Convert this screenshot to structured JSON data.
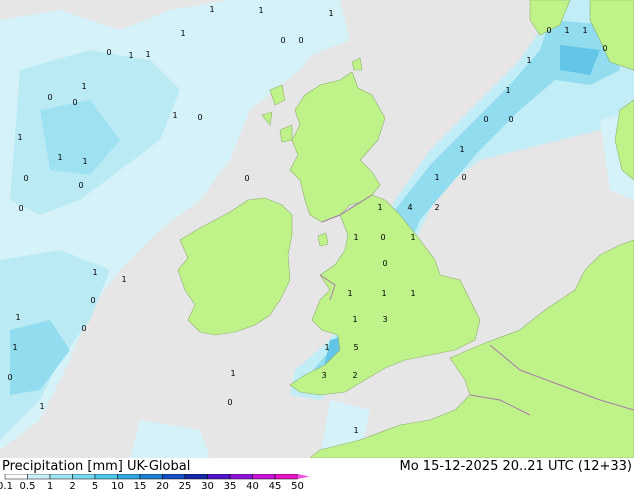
{
  "footer": {
    "title_left": "Precipitation [mm]  UK-Global",
    "title_right": "Mo 15-12-2025 20..21 UTC (12+33)"
  },
  "legend": {
    "labels": [
      "0.1",
      "0.5",
      "1",
      "2",
      "5",
      "10",
      "15",
      "20",
      "25",
      "30",
      "35",
      "40",
      "45",
      "50"
    ],
    "colors": [
      "#ffffff",
      "#c8f0f8",
      "#a0e4f4",
      "#78d8f0",
      "#50c8ec",
      "#30a8e0",
      "#1e7fd0",
      "#1450c0",
      "#1428a8",
      "#5014c8",
      "#8c14d8",
      "#c814d8",
      "#e614c8",
      "#f050e0"
    ]
  },
  "colors": {
    "sea": "#e6e6e6",
    "land": "#bff38a",
    "border": "#aa7aaa",
    "precip_light": "#c8f0f8",
    "precip_mid": "#8edcf0",
    "precip_heavy": "#5cc4e8"
  },
  "map_values": [
    "1",
    "1",
    "0",
    "1",
    "1",
    "1",
    "0",
    "1",
    "1",
    "1",
    "0",
    "0",
    "1",
    "0",
    "0",
    "1",
    "1",
    "4",
    "2",
    "1",
    "1",
    "0",
    "1",
    "0",
    "0",
    "1",
    "1",
    "1",
    "3",
    "1",
    "5",
    "3",
    "2",
    "1",
    "1",
    "1",
    "0",
    "1",
    "1",
    "0",
    "0",
    "1",
    "1",
    "0",
    "1",
    "1",
    "1",
    "0",
    "1",
    "0",
    "0",
    "0",
    "0",
    "1",
    "1",
    "0",
    "0",
    "1",
    "0"
  ]
}
